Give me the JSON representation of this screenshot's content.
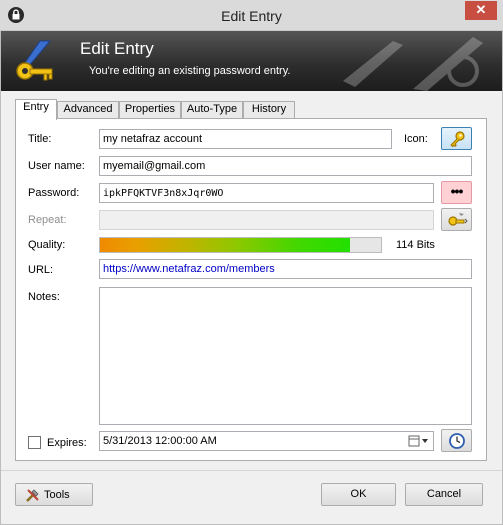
{
  "window": {
    "title": "Edit Entry",
    "close_glyph": "✕"
  },
  "banner": {
    "title": "Edit Entry",
    "subtitle": "You're editing an existing password entry.",
    "icon": "key-pen-icon"
  },
  "tabs": [
    {
      "label": "Entry",
      "active": true
    },
    {
      "label": "Advanced",
      "active": false
    },
    {
      "label": "Properties",
      "active": false
    },
    {
      "label": "Auto-Type",
      "active": false
    },
    {
      "label": "History",
      "active": false
    }
  ],
  "form": {
    "title_label": "Title:",
    "title_value": "my netafraz account",
    "icon_label": "Icon:",
    "username_label": "User name:",
    "username_value": "myemail@gmail.com",
    "password_label": "Password:",
    "password_value": "ipkPFQKTVF3n8xJqr0WO",
    "reveal_label": "•••",
    "repeat_label": "Repeat:",
    "repeat_value": "",
    "quality_label": "Quality:",
    "quality_fraction": 0.89,
    "quality_bits": "114 Bits",
    "url_label": "URL:",
    "url_value": "https://www.netafraz.com/members",
    "notes_label": "Notes:",
    "notes_value": "",
    "expires_label": "Expires:",
    "expires_checked": false,
    "expires_value": "5/31/2013 12:00:00 AM"
  },
  "buttons": {
    "tools": "Tools",
    "ok": "OK",
    "cancel": "Cancel"
  },
  "colors": {
    "close": "#c74e41",
    "reveal": "#ffd0d4",
    "url": "#0000c8",
    "quality_start": "#ef8a00",
    "quality_end": "#22e000"
  }
}
